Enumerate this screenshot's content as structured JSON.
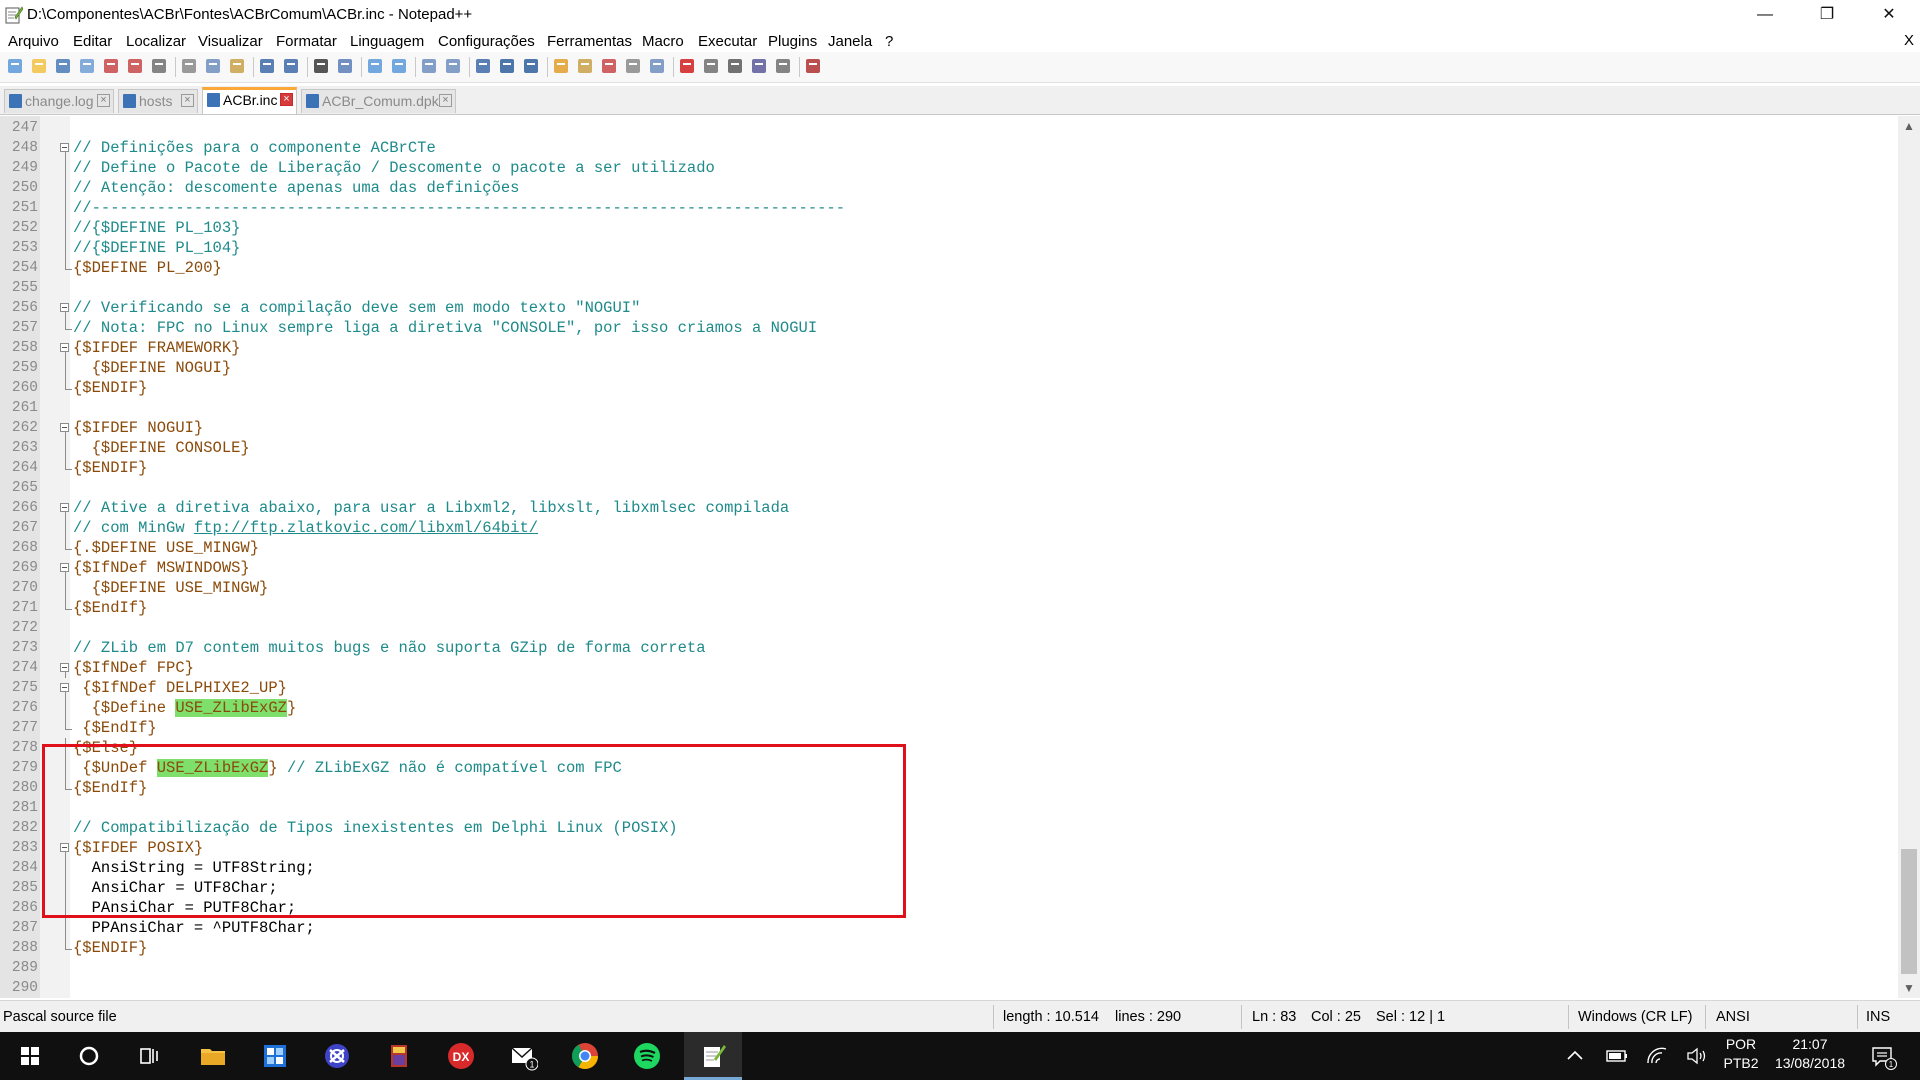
{
  "window": {
    "title": "D:\\Componentes\\ACBr\\Fontes\\ACBrComum\\ACBr.inc - Notepad++",
    "minimize_glyph": "—",
    "restore_glyph": "❐",
    "close_glyph": "✕"
  },
  "menu": {
    "items": [
      "Arquivo",
      "Editar",
      "Localizar",
      "Visualizar",
      "Formatar",
      "Linguagem",
      "Configurações",
      "Ferramentas",
      "Macro",
      "Executar",
      "Plugins",
      "Janela",
      "?"
    ],
    "close_doc": "X"
  },
  "toolbar": {
    "icons": [
      "new-file-icon",
      "open-file-icon",
      "save-icon",
      "save-all-icon",
      "close-icon",
      "close-all-icon",
      "print-icon",
      "cut-icon",
      "copy-icon",
      "paste-icon",
      "undo-icon",
      "redo-icon",
      "find-icon",
      "replace-icon",
      "zoom-in-icon",
      "zoom-out-icon",
      "sync-v-icon",
      "sync-h-icon",
      "word-wrap-icon",
      "show-all-chars-icon",
      "indent-guide-icon",
      "doc-map-icon",
      "function-list-icon",
      "folder-workspace-icon",
      "doc-list-icon",
      "monitoring-icon",
      "record-macro-icon",
      "stop-macro-icon",
      "play-macro-icon",
      "run-macro-multiple-icon",
      "save-macro-icon",
      "spellcheck-icon"
    ]
  },
  "tabs": [
    {
      "label": "change.log",
      "active": false
    },
    {
      "label": "hosts",
      "active": false
    },
    {
      "label": "ACBr.inc",
      "active": true
    },
    {
      "label": "ACBr_Comum.dpk",
      "active": false
    }
  ],
  "editor": {
    "lines": [
      {
        "n": "247",
        "fold": "none",
        "parts": []
      },
      {
        "n": "248",
        "fold": "start",
        "parts": [
          {
            "c": "comment",
            "t": "// Definições para o componente ACBrCTe"
          }
        ]
      },
      {
        "n": "249",
        "fold": "line",
        "parts": [
          {
            "c": "comment",
            "t": "// Define o Pacote de Liberação / Descomente o pacote a ser utilizado"
          }
        ]
      },
      {
        "n": "250",
        "fold": "line",
        "parts": [
          {
            "c": "comment",
            "t": "// Atenção: descomente apenas uma das definições"
          }
        ]
      },
      {
        "n": "251",
        "fold": "line",
        "parts": [
          {
            "c": "comment",
            "t": "//---------------------------------------------------------------------------------"
          }
        ]
      },
      {
        "n": "252",
        "fold": "line",
        "parts": [
          {
            "c": "comment",
            "t": "//{$DEFINE PL_103}"
          }
        ]
      },
      {
        "n": "253",
        "fold": "line",
        "parts": [
          {
            "c": "comment",
            "t": "//{$DEFINE PL_104}"
          }
        ]
      },
      {
        "n": "254",
        "fold": "end",
        "parts": [
          {
            "c": "dir",
            "t": "{$DEFINE PL_200}"
          }
        ]
      },
      {
        "n": "255",
        "fold": "none",
        "parts": []
      },
      {
        "n": "256",
        "fold": "start",
        "parts": [
          {
            "c": "comment",
            "t": "// Verificando se a compilação deve sem em modo texto \"NOGUI\""
          }
        ]
      },
      {
        "n": "257",
        "fold": "end",
        "parts": [
          {
            "c": "comment",
            "t": "// Nota: FPC no Linux sempre liga a diretiva \"CONSOLE\", por isso criamos a NOGUI"
          }
        ]
      },
      {
        "n": "258",
        "fold": "start",
        "parts": [
          {
            "c": "dir",
            "t": "{$IFDEF FRAMEWORK}"
          }
        ]
      },
      {
        "n": "259",
        "fold": "line",
        "parts": [
          {
            "c": "dir",
            "t": "  {$DEFINE NOGUI}"
          }
        ]
      },
      {
        "n": "260",
        "fold": "end",
        "parts": [
          {
            "c": "dir",
            "t": "{$ENDIF}"
          }
        ]
      },
      {
        "n": "261",
        "fold": "none",
        "parts": []
      },
      {
        "n": "262",
        "fold": "start",
        "parts": [
          {
            "c": "dir",
            "t": "{$IFDEF NOGUI}"
          }
        ]
      },
      {
        "n": "263",
        "fold": "line",
        "parts": [
          {
            "c": "dir",
            "t": "  {$DEFINE CONSOLE}"
          }
        ]
      },
      {
        "n": "264",
        "fold": "end",
        "parts": [
          {
            "c": "dir",
            "t": "{$ENDIF}"
          }
        ]
      },
      {
        "n": "265",
        "fold": "none",
        "parts": []
      },
      {
        "n": "266",
        "fold": "start",
        "parts": [
          {
            "c": "comment",
            "t": "// Ative a diretiva abaixo, para usar a Libxml2, libxslt, libxmlsec compilada"
          }
        ]
      },
      {
        "n": "267",
        "fold": "line",
        "parts": [
          {
            "c": "comment",
            "t": "// com MinGw "
          },
          {
            "c": "url",
            "t": "ftp://ftp.zlatkovic.com/libxml/64bit/"
          }
        ]
      },
      {
        "n": "268",
        "fold": "end",
        "parts": [
          {
            "c": "dir",
            "t": "{.$DEFINE USE_MINGW}"
          }
        ]
      },
      {
        "n": "269",
        "fold": "start",
        "parts": [
          {
            "c": "dir",
            "t": "{$IfNDef MSWINDOWS}"
          }
        ]
      },
      {
        "n": "270",
        "fold": "line",
        "parts": [
          {
            "c": "dir",
            "t": "  {$DEFINE USE_MINGW}"
          }
        ]
      },
      {
        "n": "271",
        "fold": "end",
        "parts": [
          {
            "c": "dir",
            "t": "{$EndIf}"
          }
        ]
      },
      {
        "n": "272",
        "fold": "none",
        "parts": []
      },
      {
        "n": "273",
        "fold": "none",
        "parts": [
          {
            "c": "comment",
            "t": "// ZLib em D7 contem muitos bugs e não suporta GZip de forma correta"
          }
        ]
      },
      {
        "n": "274",
        "fold": "start",
        "parts": [
          {
            "c": "dir",
            "t": "{$IfNDef FPC}"
          }
        ]
      },
      {
        "n": "275",
        "fold": "start",
        "parts": [
          {
            "c": "dir",
            "t": " {$IfNDef DELPHIXE2_UP}"
          }
        ]
      },
      {
        "n": "276",
        "fold": "line",
        "parts": [
          {
            "c": "dir",
            "t": "  {$Define "
          },
          {
            "c": "dirhl",
            "t": "USE_ZLibExGZ"
          },
          {
            "c": "dir",
            "t": "}"
          }
        ]
      },
      {
        "n": "277",
        "fold": "end",
        "parts": [
          {
            "c": "dir",
            "t": " {$EndIf}"
          }
        ]
      },
      {
        "n": "278",
        "fold": "line",
        "parts": [
          {
            "c": "dir",
            "t": "{$Else}"
          }
        ]
      },
      {
        "n": "279",
        "fold": "line",
        "parts": [
          {
            "c": "dir",
            "t": " {$UnDef "
          },
          {
            "c": "dirhl",
            "t": "USE_ZLibExGZ"
          },
          {
            "c": "dir",
            "t": "} "
          },
          {
            "c": "comment",
            "t": "// ZLibExGZ não é compatível com FPC"
          }
        ]
      },
      {
        "n": "280",
        "fold": "end",
        "parts": [
          {
            "c": "dir",
            "t": "{$EndIf}"
          }
        ]
      },
      {
        "n": "281",
        "fold": "none",
        "parts": []
      },
      {
        "n": "282",
        "fold": "none",
        "parts": [
          {
            "c": "comment",
            "t": "// Compatibilização de Tipos inexistentes em Delphi Linux (POSIX)"
          }
        ]
      },
      {
        "n": "283",
        "fold": "start",
        "parts": [
          {
            "c": "dir",
            "t": "{$IFDEF POSIX}"
          }
        ]
      },
      {
        "n": "284",
        "fold": "line",
        "parts": [
          {
            "c": "text",
            "t": "  AnsiString = UTF8String;"
          }
        ]
      },
      {
        "n": "285",
        "fold": "line",
        "parts": [
          {
            "c": "text",
            "t": "  AnsiChar = UTF8Char;"
          }
        ]
      },
      {
        "n": "286",
        "fold": "line",
        "parts": [
          {
            "c": "text",
            "t": "  PAnsiChar = PUTF8Char;"
          }
        ]
      },
      {
        "n": "287",
        "fold": "line",
        "parts": [
          {
            "c": "text",
            "t": "  PPAnsiChar = ^PUTF8Char;"
          }
        ]
      },
      {
        "n": "288",
        "fold": "end",
        "parts": [
          {
            "c": "dir",
            "t": "{$ENDIF}"
          }
        ]
      },
      {
        "n": "289",
        "fold": "none",
        "parts": []
      },
      {
        "n": "290",
        "fold": "none",
        "parts": []
      }
    ]
  },
  "statusbar": {
    "file_type": "Pascal source file",
    "length": "length : 10.514",
    "lines": "lines : 290",
    "ln": "Ln : 83",
    "col": "Col : 25",
    "sel": "Sel : 12 | 1",
    "eol": "Windows (CR LF)",
    "encoding": "ANSI",
    "mode": "INS"
  },
  "taskbar": {
    "lang_1": "POR",
    "lang_2": "PTB2",
    "time": "21:07",
    "date": "13/08/2018",
    "mail_badge": "1",
    "notif_badge": "1",
    "apps": [
      "windows-start-icon",
      "cortana-search-icon",
      "task-view-icon",
      "file-explorer-icon",
      "calculator-app-icon",
      "network-app-icon",
      "archive-app-icon",
      "devexpress-app-icon",
      "mail-app-icon",
      "chrome-icon",
      "spotify-icon",
      "notepadpp-icon"
    ]
  },
  "colors": {
    "comment": "#1f8a8a",
    "directive": "#8a4a0a",
    "highlight": "#7ee06a",
    "box": "#e0101a"
  }
}
